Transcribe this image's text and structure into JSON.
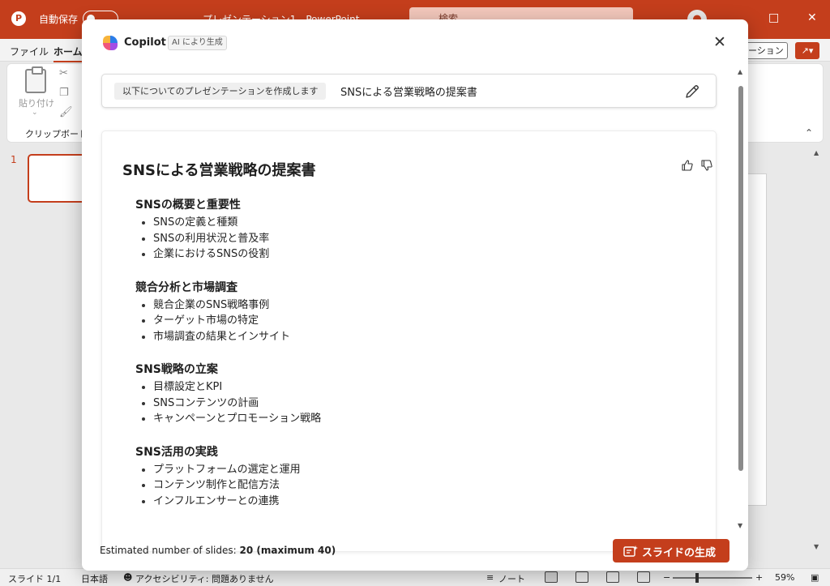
{
  "titlebar": {
    "autosave_label": "自動保存",
    "toggle_state": "オフ",
    "document_title": "プレゼンテーション1 - PowerPoint",
    "search_placeholder": "検索",
    "avatar_icon": "person-icon",
    "colors": {
      "accent": "#c43e1c"
    }
  },
  "ribbon": {
    "tabs": [
      {
        "label": "ファイル"
      },
      {
        "label": "ホーム",
        "active": true
      }
    ],
    "present_label": "ーション",
    "share_icon": "share-icon",
    "clipboard": {
      "paste_label": "貼り付け",
      "group_label": "クリップボード"
    }
  },
  "slides_panel": {
    "slide_number": "1"
  },
  "statusbar": {
    "slide_counter": "スライド 1/1",
    "language": "日本語",
    "accessibility": "アクセシビリティ: 問題ありません",
    "notes_label": "ノート",
    "zoom": "59%"
  },
  "copilot": {
    "title": "Copilot",
    "ai_badge": "AI により生成",
    "prompt": {
      "chip": "以下についてのプレゼンテーションを作成します",
      "text": "SNSによる営業戦略の提案書"
    },
    "outline": {
      "title": "SNSによる営業戦略の提案書",
      "sections": [
        {
          "title": "SNSの概要と重要性",
          "items": [
            "SNSの定義と種類",
            "SNSの利用状況と普及率",
            "企業におけるSNSの役割"
          ]
        },
        {
          "title": "競合分析と市場調査",
          "items": [
            "競合企業のSNS戦略事例",
            "ターゲット市場の特定",
            "市場調査の結果とインサイト"
          ]
        },
        {
          "title": "SNS戦略の立案",
          "items": [
            "目標設定とKPI",
            "SNSコンテンツの計画",
            "キャンペーンとプロモーション戦略"
          ]
        },
        {
          "title": "SNS活用の実践",
          "items": [
            "プラットフォームの選定と運用",
            "コンテンツ制作と配信方法",
            "インフルエンサーとの連携"
          ]
        }
      ]
    },
    "footer": {
      "estimate_label": "Estimated number of slides:",
      "estimate_value": "20 (maximum 40)",
      "generate_label": "スライドの生成"
    }
  }
}
